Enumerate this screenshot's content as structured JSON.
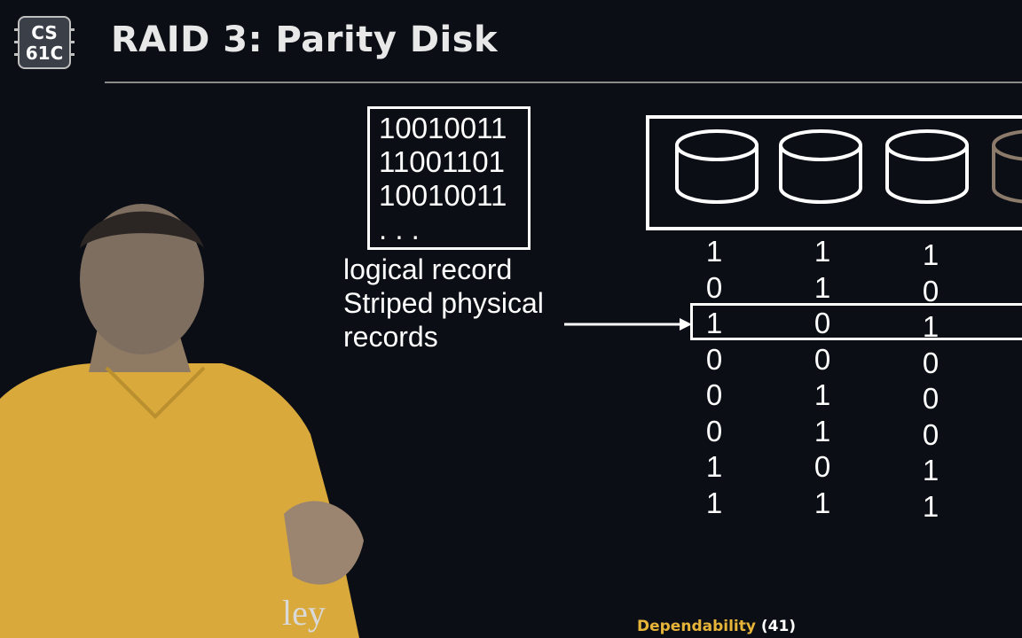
{
  "logo": {
    "line1": "CS",
    "line2": "61C"
  },
  "title": "RAID 3: Parity Disk",
  "logical_record": {
    "lines": [
      "10010011",
      "11001101",
      "10010011",
      ". . ."
    ],
    "label": "logical record"
  },
  "striped_label": {
    "line1": "Striped physical",
    "line2": "records"
  },
  "disk_columns": [
    {
      "bits": [
        "1",
        "0",
        "1",
        "0",
        "0",
        "0",
        "1",
        "1"
      ]
    },
    {
      "bits": [
        "1",
        "1",
        "0",
        "0",
        "1",
        "1",
        "0",
        "1"
      ]
    },
    {
      "bits": [
        "1",
        "0",
        "1",
        "0",
        "0",
        "0",
        "1",
        "1"
      ]
    }
  ],
  "footer": {
    "topic": "Dependability",
    "page": "(41)"
  },
  "watermark": "ley",
  "colors": {
    "background": "#0b0e14",
    "footer_topic": "#e7b43a",
    "shirt": "#d9a93b",
    "parity_disk": "#8c7b6a"
  }
}
